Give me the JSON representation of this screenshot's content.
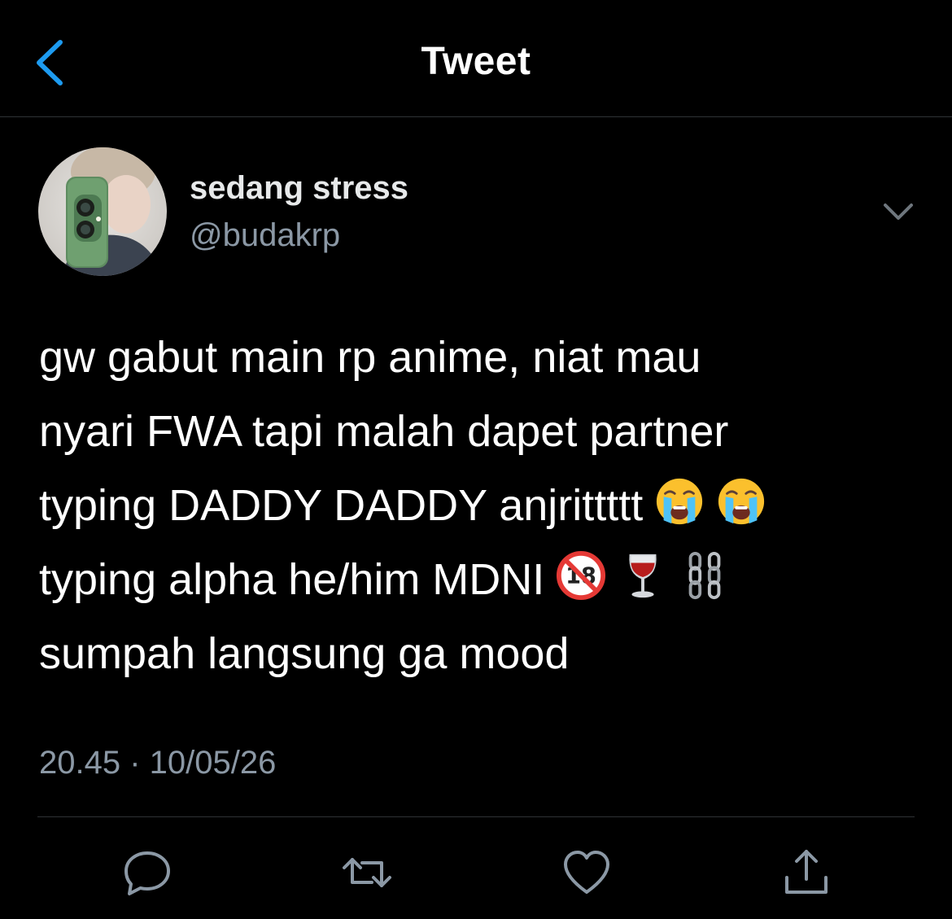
{
  "header": {
    "title": "Tweet"
  },
  "author": {
    "display_name": "sedang stress",
    "handle": "@budakrp"
  },
  "tweet": {
    "line1": "gw gabut main rp anime, niat mau",
    "line2": "nyari FWA tapi malah dapet partner",
    "line3": "typing DADDY DADDY anjrittttt",
    "line3_emojis": [
      "crying-face-emoji",
      "crying-face-emoji"
    ],
    "line4": "typing alpha he/him MDNI",
    "line4_emojis": [
      "no-one-under-eighteen-emoji",
      "wine-glass-emoji",
      "chains-emoji"
    ],
    "line5": "sumpah langsung ga mood",
    "timestamp": "20.45 · 10/05/26"
  },
  "actions": [
    "reply-icon",
    "retweet-icon",
    "like-icon",
    "share-icon"
  ],
  "colors": {
    "background": "#000000",
    "text": "#ffffff",
    "secondary_text": "#8b98a5",
    "accent": "#1d9bf0",
    "border": "#2f3336"
  }
}
